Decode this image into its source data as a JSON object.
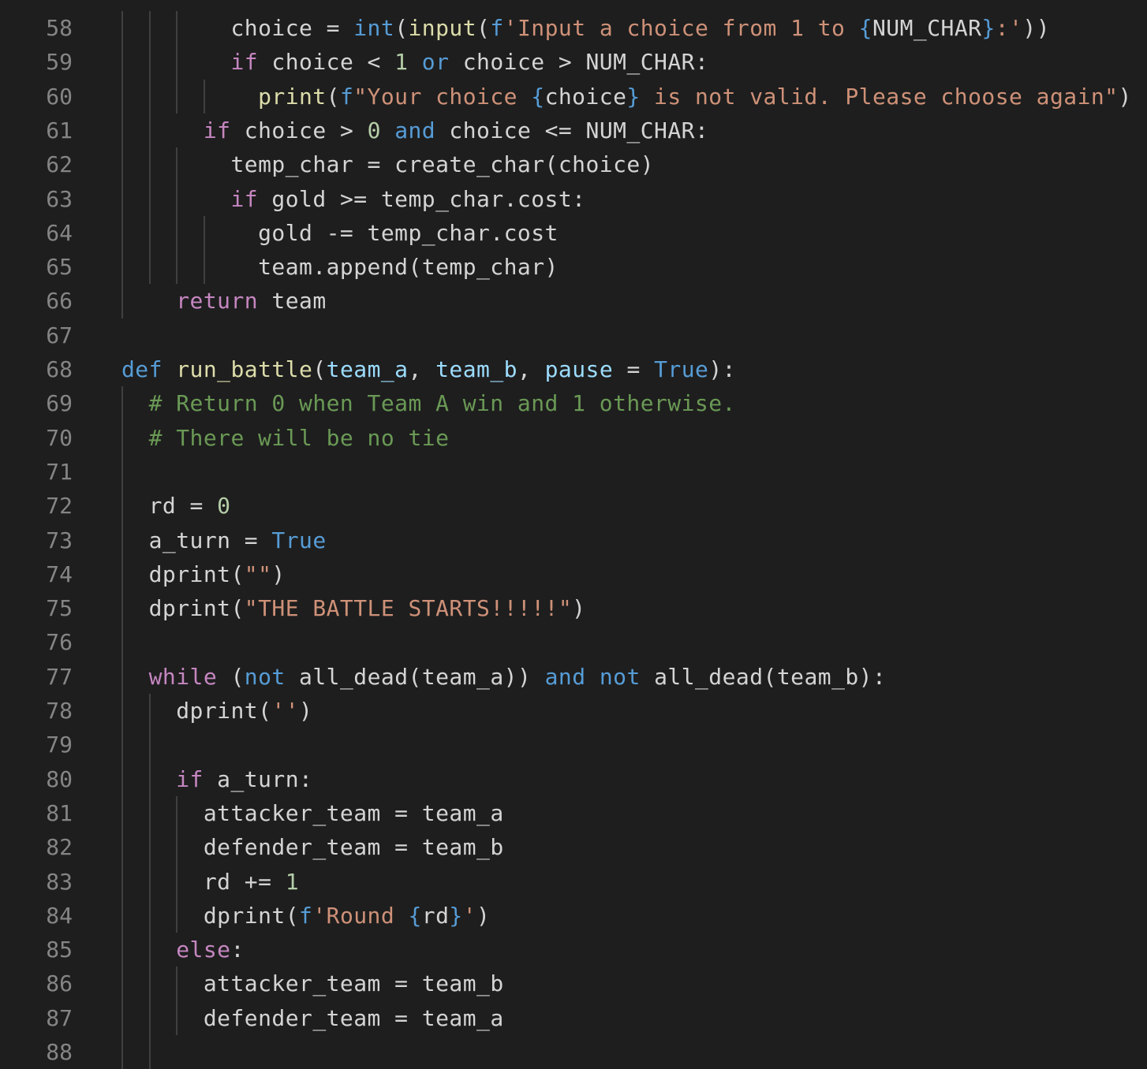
{
  "editor": {
    "language": "python",
    "theme": "dark",
    "colors": {
      "background": "#1e1e1e",
      "line_number": "#858585",
      "default": "#d4d4d4",
      "keyword_control": "#c586c0",
      "keyword": "#569cd6",
      "function": "#dcdcaa",
      "string": "#ce9178",
      "number": "#b5cea8",
      "comment": "#6a9955",
      "parameter": "#9cdcfe",
      "indent_guide": "#404040"
    },
    "lines": [
      {
        "n": "58",
        "tokens": [
          {
            "t": "        ",
            "c": "default"
          },
          {
            "t": "choice = ",
            "c": "default"
          },
          {
            "t": "int",
            "c": "keyword"
          },
          {
            "t": "(",
            "c": "default"
          },
          {
            "t": "input",
            "c": "function"
          },
          {
            "t": "(",
            "c": "default"
          },
          {
            "t": "f",
            "c": "keyword"
          },
          {
            "t": "'Input a choice from 1 to ",
            "c": "string"
          },
          {
            "t": "{",
            "c": "keyword"
          },
          {
            "t": "NUM_CHAR",
            "c": "default"
          },
          {
            "t": "}",
            "c": "keyword"
          },
          {
            "t": ":'",
            "c": "string"
          },
          {
            "t": "))",
            "c": "default"
          }
        ]
      },
      {
        "n": "59",
        "tokens": [
          {
            "t": "        ",
            "c": "default"
          },
          {
            "t": "if",
            "c": "keyword_control"
          },
          {
            "t": " choice < ",
            "c": "default"
          },
          {
            "t": "1",
            "c": "number"
          },
          {
            "t": " ",
            "c": "default"
          },
          {
            "t": "or",
            "c": "keyword"
          },
          {
            "t": " choice > NUM_CHAR:",
            "c": "default"
          }
        ]
      },
      {
        "n": "60",
        "tokens": [
          {
            "t": "          ",
            "c": "default"
          },
          {
            "t": "print",
            "c": "function"
          },
          {
            "t": "(",
            "c": "default"
          },
          {
            "t": "f",
            "c": "keyword"
          },
          {
            "t": "\"Your choice ",
            "c": "string"
          },
          {
            "t": "{",
            "c": "keyword"
          },
          {
            "t": "choice",
            "c": "default"
          },
          {
            "t": "}",
            "c": "keyword"
          },
          {
            "t": " is not valid. Please choose again\"",
            "c": "string"
          },
          {
            "t": ")",
            "c": "default"
          }
        ]
      },
      {
        "n": "61",
        "tokens": [
          {
            "t": "      ",
            "c": "default"
          },
          {
            "t": "if",
            "c": "keyword_control"
          },
          {
            "t": " choice > ",
            "c": "default"
          },
          {
            "t": "0",
            "c": "number"
          },
          {
            "t": " ",
            "c": "default"
          },
          {
            "t": "and",
            "c": "keyword"
          },
          {
            "t": " choice <= NUM_CHAR:",
            "c": "default"
          }
        ]
      },
      {
        "n": "62",
        "tokens": [
          {
            "t": "        ",
            "c": "default"
          },
          {
            "t": "temp_char = create_char(choice)",
            "c": "default"
          }
        ]
      },
      {
        "n": "63",
        "tokens": [
          {
            "t": "        ",
            "c": "default"
          },
          {
            "t": "if",
            "c": "keyword_control"
          },
          {
            "t": " gold >= temp_char.cost:",
            "c": "default"
          }
        ]
      },
      {
        "n": "64",
        "tokens": [
          {
            "t": "          ",
            "c": "default"
          },
          {
            "t": "gold -= temp_char.cost",
            "c": "default"
          }
        ]
      },
      {
        "n": "65",
        "tokens": [
          {
            "t": "          ",
            "c": "default"
          },
          {
            "t": "team.append(temp_char)",
            "c": "default"
          }
        ]
      },
      {
        "n": "66",
        "tokens": [
          {
            "t": "    ",
            "c": "default"
          },
          {
            "t": "return",
            "c": "keyword_control"
          },
          {
            "t": " team",
            "c": "default"
          }
        ]
      },
      {
        "n": "67",
        "tokens": []
      },
      {
        "n": "68",
        "tokens": [
          {
            "t": "def",
            "c": "keyword"
          },
          {
            "t": " ",
            "c": "default"
          },
          {
            "t": "run_battle",
            "c": "function"
          },
          {
            "t": "(",
            "c": "default"
          },
          {
            "t": "team_a",
            "c": "parameter"
          },
          {
            "t": ", ",
            "c": "default"
          },
          {
            "t": "team_b",
            "c": "parameter"
          },
          {
            "t": ", ",
            "c": "default"
          },
          {
            "t": "pause",
            "c": "parameter"
          },
          {
            "t": " = ",
            "c": "default"
          },
          {
            "t": "True",
            "c": "keyword"
          },
          {
            "t": "):",
            "c": "default"
          }
        ]
      },
      {
        "n": "69",
        "tokens": [
          {
            "t": "  ",
            "c": "default"
          },
          {
            "t": "# Return 0 when Team A win and 1 otherwise.",
            "c": "comment"
          }
        ]
      },
      {
        "n": "70",
        "tokens": [
          {
            "t": "  ",
            "c": "default"
          },
          {
            "t": "# There will be no tie",
            "c": "comment"
          }
        ]
      },
      {
        "n": "71",
        "tokens": []
      },
      {
        "n": "72",
        "tokens": [
          {
            "t": "  ",
            "c": "default"
          },
          {
            "t": "rd = ",
            "c": "default"
          },
          {
            "t": "0",
            "c": "number"
          }
        ]
      },
      {
        "n": "73",
        "tokens": [
          {
            "t": "  ",
            "c": "default"
          },
          {
            "t": "a_turn = ",
            "c": "default"
          },
          {
            "t": "True",
            "c": "keyword"
          }
        ]
      },
      {
        "n": "74",
        "tokens": [
          {
            "t": "  ",
            "c": "default"
          },
          {
            "t": "dprint(",
            "c": "default"
          },
          {
            "t": "\"\"",
            "c": "string"
          },
          {
            "t": ")",
            "c": "default"
          }
        ]
      },
      {
        "n": "75",
        "tokens": [
          {
            "t": "  ",
            "c": "default"
          },
          {
            "t": "dprint(",
            "c": "default"
          },
          {
            "t": "\"THE BATTLE STARTS!!!!!\"",
            "c": "string"
          },
          {
            "t": ")",
            "c": "default"
          }
        ]
      },
      {
        "n": "76",
        "tokens": []
      },
      {
        "n": "77",
        "tokens": [
          {
            "t": "  ",
            "c": "default"
          },
          {
            "t": "while",
            "c": "keyword_control"
          },
          {
            "t": " (",
            "c": "default"
          },
          {
            "t": "not",
            "c": "keyword"
          },
          {
            "t": " all_dead(team_a)) ",
            "c": "default"
          },
          {
            "t": "and",
            "c": "keyword"
          },
          {
            "t": " ",
            "c": "default"
          },
          {
            "t": "not",
            "c": "keyword"
          },
          {
            "t": " all_dead(team_b):",
            "c": "default"
          }
        ]
      },
      {
        "n": "78",
        "tokens": [
          {
            "t": "    ",
            "c": "default"
          },
          {
            "t": "dprint(",
            "c": "default"
          },
          {
            "t": "''",
            "c": "string"
          },
          {
            "t": ")",
            "c": "default"
          }
        ]
      },
      {
        "n": "79",
        "tokens": []
      },
      {
        "n": "80",
        "tokens": [
          {
            "t": "    ",
            "c": "default"
          },
          {
            "t": "if",
            "c": "keyword_control"
          },
          {
            "t": " a_turn:",
            "c": "default"
          }
        ]
      },
      {
        "n": "81",
        "tokens": [
          {
            "t": "      ",
            "c": "default"
          },
          {
            "t": "attacker_team = team_a",
            "c": "default"
          }
        ]
      },
      {
        "n": "82",
        "tokens": [
          {
            "t": "      ",
            "c": "default"
          },
          {
            "t": "defender_team = team_b",
            "c": "default"
          }
        ]
      },
      {
        "n": "83",
        "tokens": [
          {
            "t": "      ",
            "c": "default"
          },
          {
            "t": "rd += ",
            "c": "default"
          },
          {
            "t": "1",
            "c": "number"
          }
        ]
      },
      {
        "n": "84",
        "tokens": [
          {
            "t": "      ",
            "c": "default"
          },
          {
            "t": "dprint(",
            "c": "default"
          },
          {
            "t": "f",
            "c": "keyword"
          },
          {
            "t": "'Round ",
            "c": "string"
          },
          {
            "t": "{",
            "c": "keyword"
          },
          {
            "t": "rd",
            "c": "default"
          },
          {
            "t": "}",
            "c": "keyword"
          },
          {
            "t": "'",
            "c": "string"
          },
          {
            "t": ")",
            "c": "default"
          }
        ]
      },
      {
        "n": "85",
        "tokens": [
          {
            "t": "    ",
            "c": "default"
          },
          {
            "t": "else",
            "c": "keyword_control"
          },
          {
            "t": ":",
            "c": "default"
          }
        ]
      },
      {
        "n": "86",
        "tokens": [
          {
            "t": "      ",
            "c": "default"
          },
          {
            "t": "attacker_team = team_b",
            "c": "default"
          }
        ]
      },
      {
        "n": "87",
        "tokens": [
          {
            "t": "      ",
            "c": "default"
          },
          {
            "t": "defender_team = team_a",
            "c": "default"
          }
        ]
      },
      {
        "n": "88",
        "tokens": []
      }
    ]
  }
}
